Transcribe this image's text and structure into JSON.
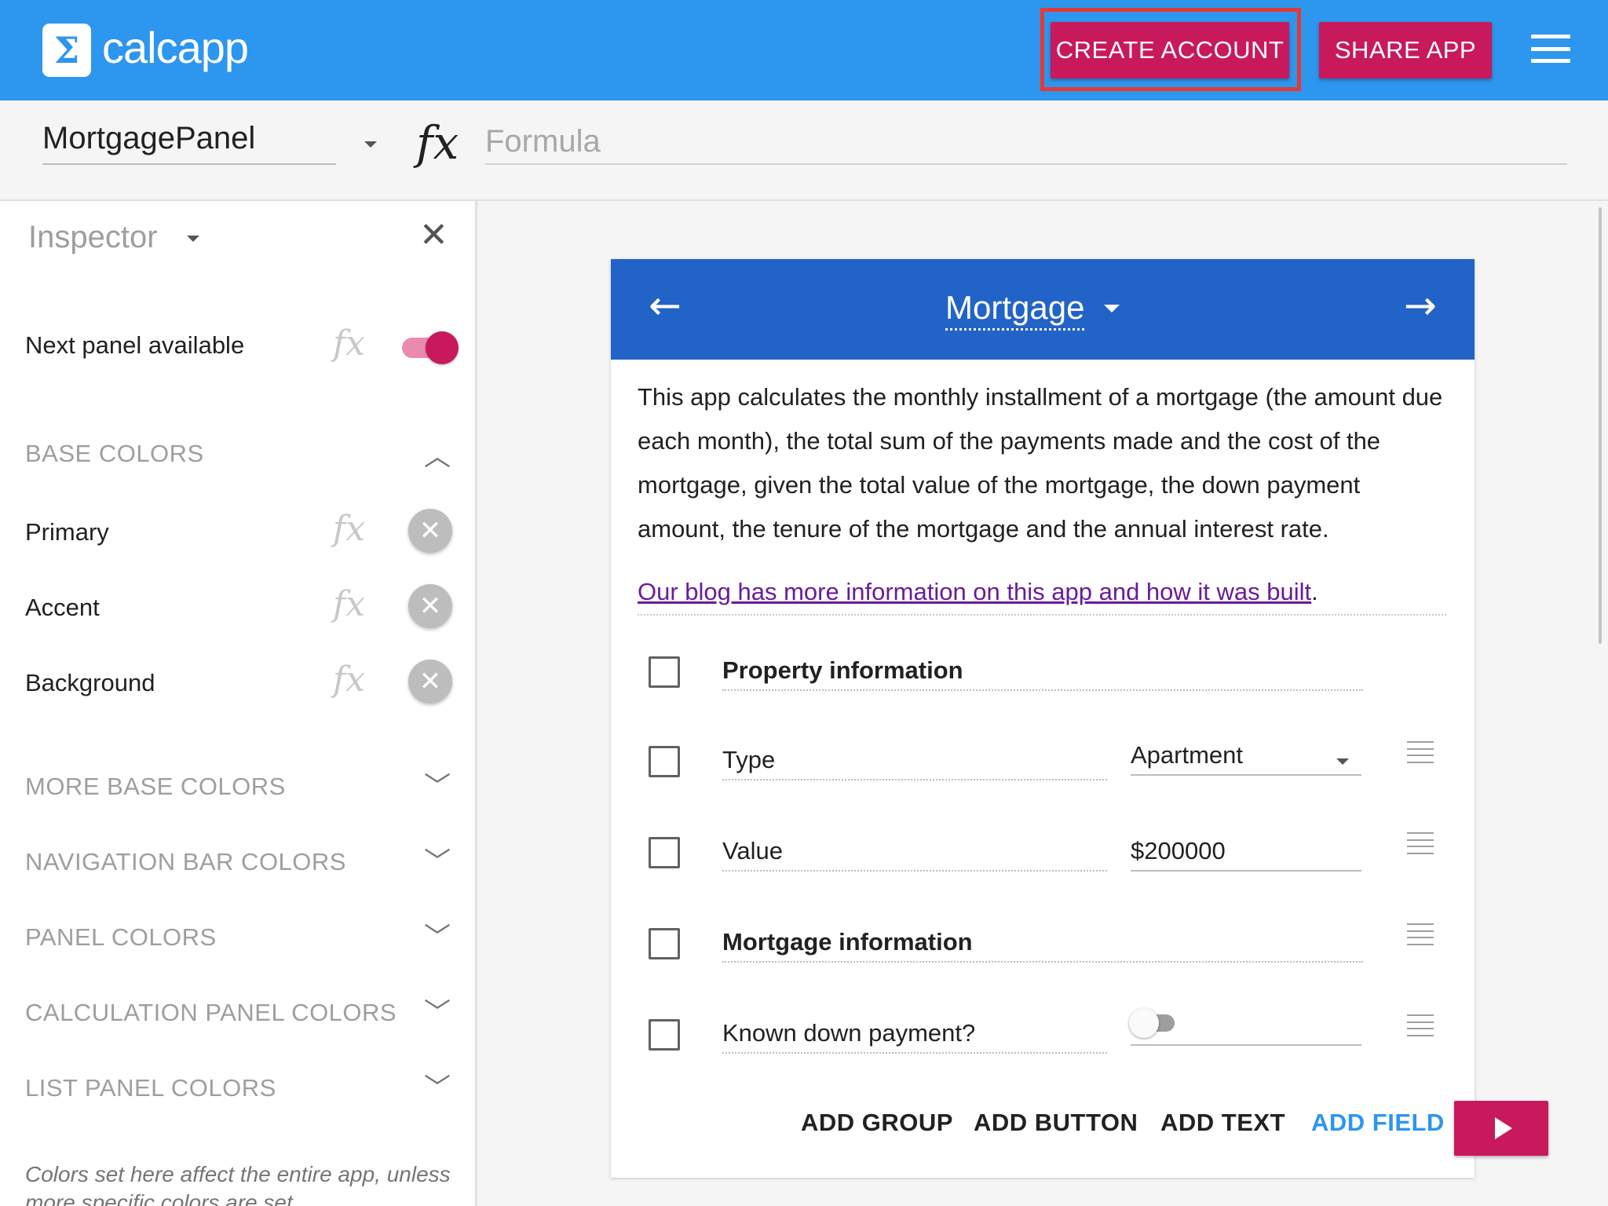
{
  "colors": {
    "appbar": "#2d96ee",
    "accent_button": "#c8195c",
    "highlight_border": "#e53935",
    "card_nav": "#2263c7",
    "link": "#6a1b9a",
    "add_field": "#2d96ee"
  },
  "header": {
    "brand": "calcapp",
    "logo_glyph": "Σ",
    "create_account": "CREATE ACCOUNT",
    "share_app": "SHARE APP",
    "menu_icon": "hamburger-icon"
  },
  "formula_bar": {
    "panel_name": "MortgagePanel",
    "fx_symbol": "fx",
    "formula_placeholder": "Formula",
    "formula_value": ""
  },
  "inspector": {
    "title": "Inspector",
    "next_panel_label": "Next panel available",
    "next_panel_enabled": true,
    "fx_symbol": "fx",
    "base_colors_header": "BASE COLORS",
    "base_colors": [
      {
        "label": "Primary"
      },
      {
        "label": "Accent"
      },
      {
        "label": "Background"
      }
    ],
    "sections": [
      "MORE BASE COLORS",
      "NAVIGATION BAR COLORS",
      "PANEL COLORS",
      "CALCULATION PANEL COLORS",
      "LIST PANEL COLORS"
    ],
    "note": "Colors set here affect the entire app, unless more specific colors are set"
  },
  "preview": {
    "nav_title": "Mortgage",
    "description": "This app calculates the monthly installment of a mortgage (the amount due each month), the total sum of the payments made and the cost of the mortgage, given the total value of the mortgage, the down payment amount, the tenure of the mortgage and the annual interest rate.",
    "blog_link": "Our blog has more information on this app and how it was built",
    "blog_suffix": ".",
    "fields": [
      {
        "label": "Property information",
        "kind": "group"
      },
      {
        "label": "Type",
        "kind": "select",
        "value": "Apartment"
      },
      {
        "label": "Value",
        "kind": "number",
        "value": "$200000"
      },
      {
        "label": "Mortgage information",
        "kind": "group"
      },
      {
        "label": "Known down payment?",
        "kind": "switch",
        "value": false
      }
    ],
    "actions": {
      "add_group": "ADD GROUP",
      "add_button": "ADD BUTTON",
      "add_text": "ADD TEXT",
      "add_field": "ADD FIELD"
    }
  }
}
